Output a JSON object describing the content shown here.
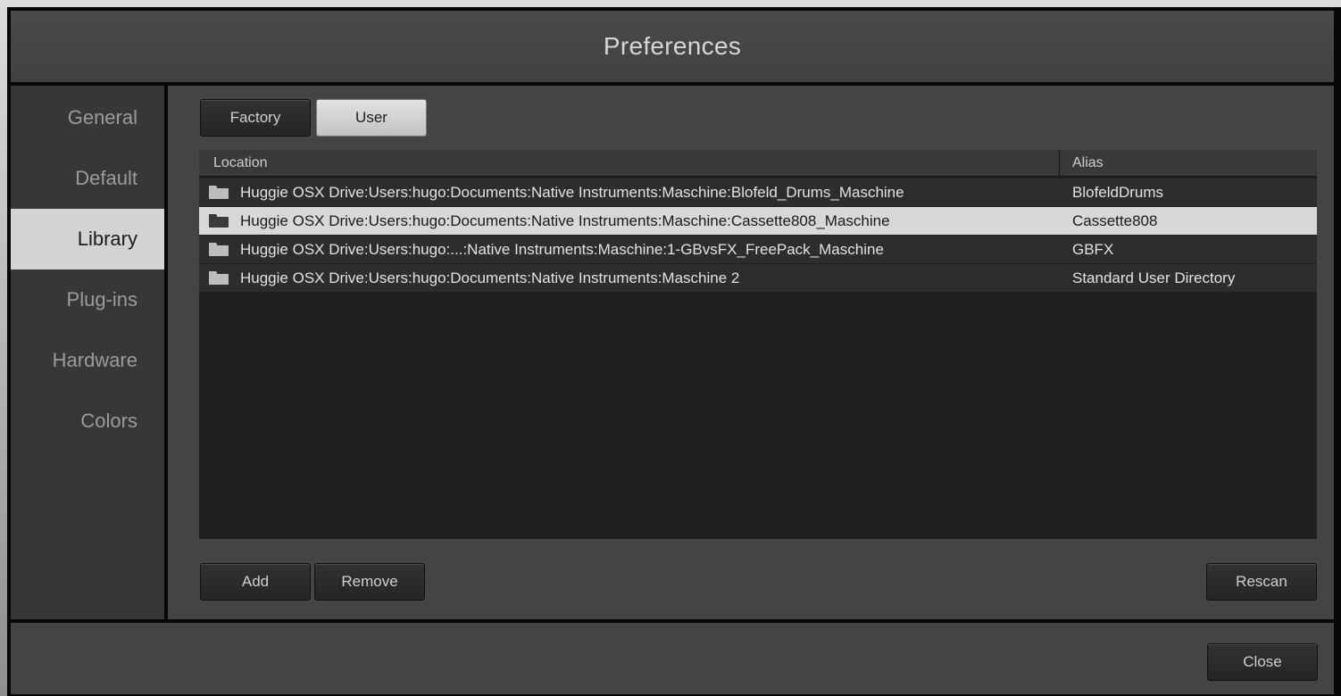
{
  "window": {
    "title": "Preferences"
  },
  "sidebar": {
    "items": [
      {
        "label": "General"
      },
      {
        "label": "Default"
      },
      {
        "label": "Library",
        "active": true
      },
      {
        "label": "Plug-ins"
      },
      {
        "label": "Hardware"
      },
      {
        "label": "Colors"
      }
    ]
  },
  "library": {
    "tabs": [
      {
        "label": "Factory"
      },
      {
        "label": "User",
        "selected": true
      }
    ],
    "table": {
      "headers": {
        "location": "Location",
        "alias": "Alias"
      },
      "rows": [
        {
          "location": "Huggie OSX Drive:Users:hugo:Documents:Native Instruments:Maschine:Blofeld_Drums_Maschine",
          "alias": "BlofeldDrums",
          "icon": "folder-icon"
        },
        {
          "location": "Huggie OSX Drive:Users:hugo:Documents:Native Instruments:Maschine:Cassette808_Maschine",
          "alias": "Cassette808",
          "icon": "folder-icon",
          "selected": true
        },
        {
          "location": "Huggie OSX Drive:Users:hugo:...:Native Instruments:Maschine:1-GBvsFX_FreePack_Maschine",
          "alias": "GBFX",
          "icon": "folder-icon"
        },
        {
          "location": "Huggie OSX Drive:Users:hugo:Documents:Native Instruments:Maschine 2",
          "alias": "Standard User Directory",
          "icon": "folder-icon"
        }
      ]
    },
    "buttons": {
      "add": "Add",
      "remove": "Remove",
      "rescan": "Rescan"
    }
  },
  "footer": {
    "close": "Close"
  },
  "colors": {
    "selected_background": "#d8d8d8",
    "panel_background": "#444444",
    "sidebar_background": "#373737"
  }
}
